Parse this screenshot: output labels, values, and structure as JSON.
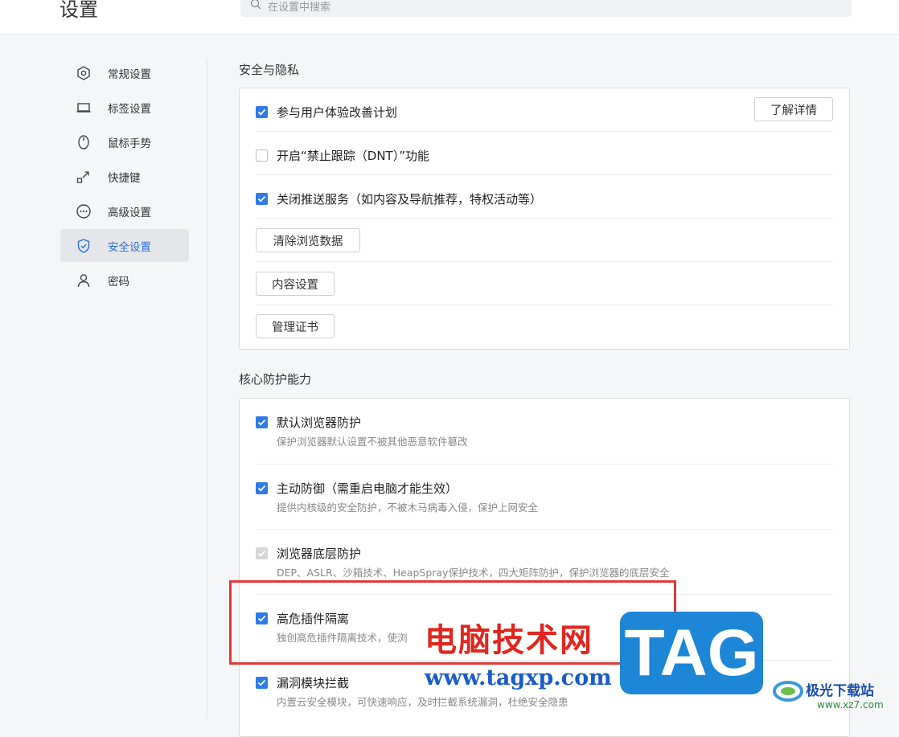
{
  "header": {
    "title": "设置",
    "search_placeholder": "在设置中搜索"
  },
  "sidebar": {
    "items": [
      {
        "label": "常规设置",
        "icon": "hexagon-gear-icon"
      },
      {
        "label": "标签设置",
        "icon": "laptop-icon"
      },
      {
        "label": "鼠标手势",
        "icon": "mouse-icon"
      },
      {
        "label": "快捷键",
        "icon": "shortcut-arrow-icon"
      },
      {
        "label": "高级设置",
        "icon": "more-dots-icon"
      },
      {
        "label": "安全设置",
        "icon": "shield-check-icon",
        "active": true
      },
      {
        "label": "密码",
        "icon": "person-icon"
      }
    ]
  },
  "privacy": {
    "title": "安全与隐私",
    "ux_program": "参与用户体验改善计划",
    "learn_more": "了解详情",
    "dnt": "开启“禁止跟踪（DNT）”功能",
    "push_off": "关闭推送服务（如内容及导航推荐，特权活动等）",
    "clear_data": "清除浏览数据",
    "content_settings": "内容设置",
    "manage_certs": "管理证书"
  },
  "core": {
    "title": "核心防护能力",
    "items": [
      {
        "label": "默认浏览器防护",
        "desc": "保护浏览器默认设置不被其他恶意软件篡改",
        "checked": true
      },
      {
        "label": "主动防御（需重启电脑才能生效）",
        "desc": "提供内核级的安全防护，不被木马病毒入侵，保护上网安全",
        "checked": true
      },
      {
        "label": "浏览器底层防护",
        "desc": "DEP、ASLR、沙箱技术、HeapSpray保护技术，四大矩阵防护，保护浏览器的底层安全",
        "checked": true,
        "disabled": true
      },
      {
        "label": "高危插件隔离",
        "desc": "独创高危插件隔离技术，使浏",
        "checked": true
      },
      {
        "label": "漏洞模块拦截",
        "desc": "内置云安全模块，可快速响应，及时拦截系统漏洞，杜绝安全隐患",
        "checked": true
      }
    ]
  },
  "watermark": {
    "brand_text": "电脑技术网",
    "brand_url": "www.tagxp.com",
    "tag_logo": "TAG",
    "site_name": "极光下载站",
    "site_url": "www.xz7.com"
  },
  "colors": {
    "accent": "#2f7be8",
    "highlight_border": "#e03a3a"
  }
}
